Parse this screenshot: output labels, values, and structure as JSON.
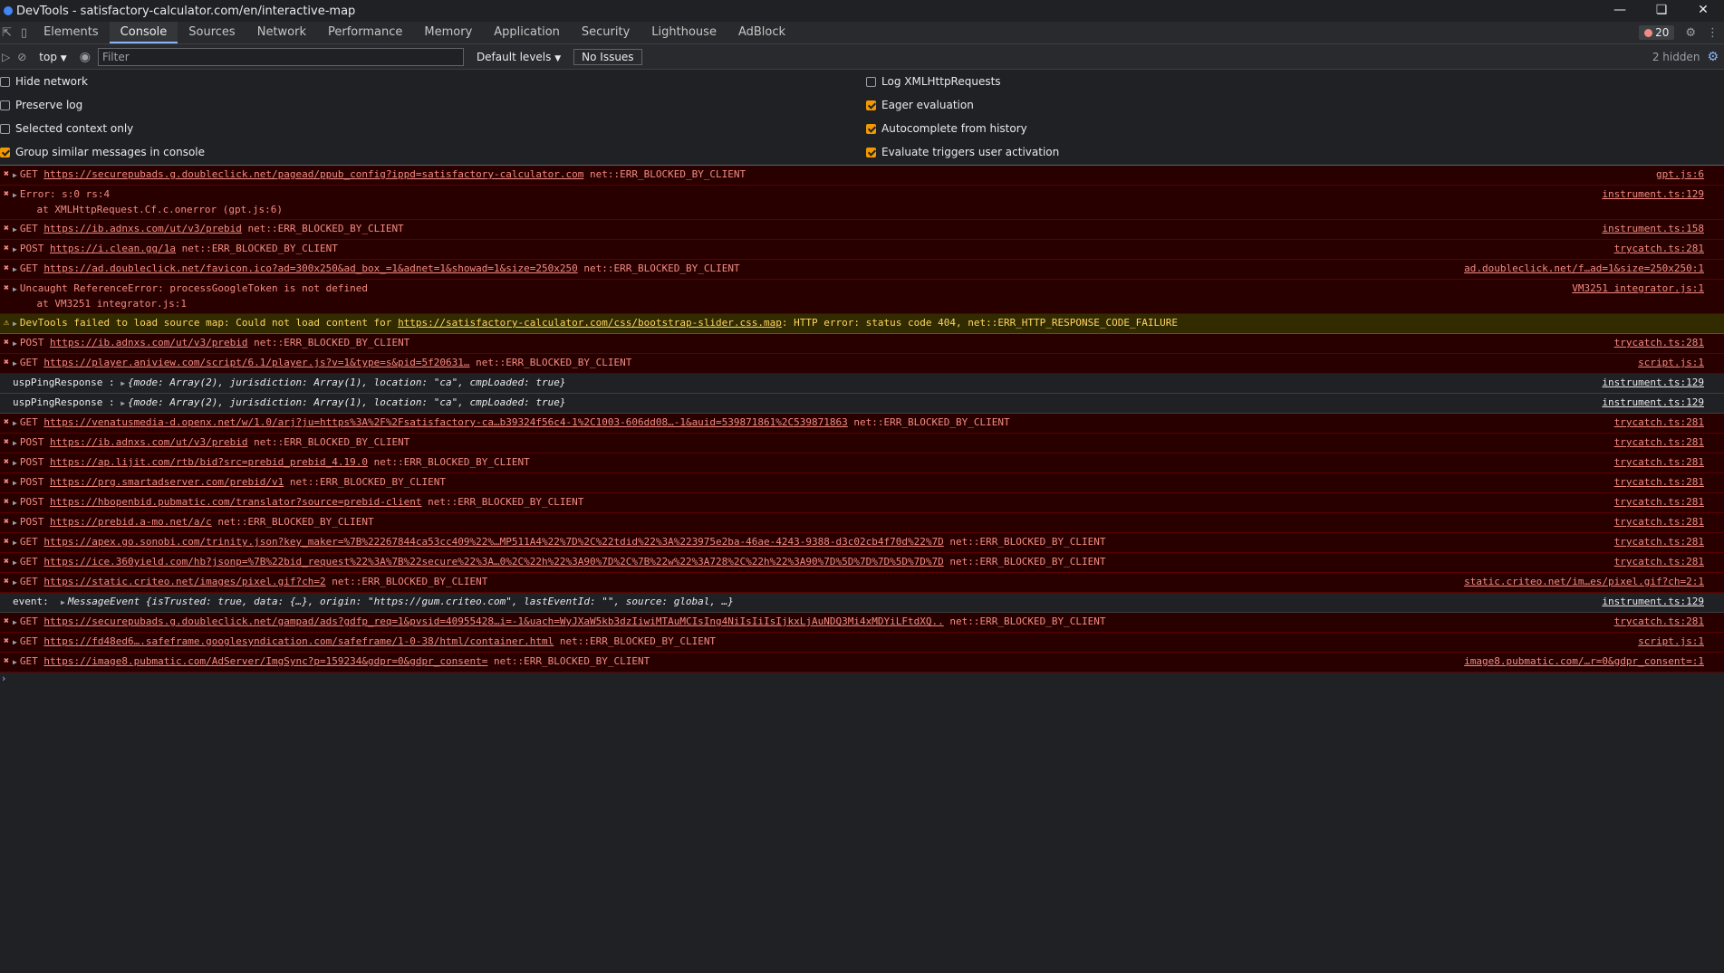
{
  "window": {
    "title": "DevTools - satisfactory-calculator.com/en/interactive-map"
  },
  "tabs": [
    "Elements",
    "Console",
    "Sources",
    "Network",
    "Performance",
    "Memory",
    "Application",
    "Security",
    "Lighthouse",
    "AdBlock"
  ],
  "error_count": "20",
  "toolbar": {
    "context": "top",
    "filter_placeholder": "Filter",
    "levels": "Default levels",
    "issues": "No Issues",
    "hidden": "2 hidden"
  },
  "settings": {
    "left": [
      {
        "label": "Hide network",
        "checked": false
      },
      {
        "label": "Preserve log",
        "checked": false
      },
      {
        "label": "Selected context only",
        "checked": false
      },
      {
        "label": "Group similar messages in console",
        "checked": true
      }
    ],
    "right": [
      {
        "label": "Log XMLHttpRequests",
        "checked": false
      },
      {
        "label": "Eager evaluation",
        "checked": true
      },
      {
        "label": "Autocomplete from history",
        "checked": true
      },
      {
        "label": "Evaluate triggers user activation",
        "checked": true
      }
    ]
  },
  "messages": [
    {
      "level": "error",
      "method": "GET",
      "url": "https://securepubads.g.doubleclick.net/pagead/ppub_config?ippd=satisfactory-calculator.com",
      "rest": " net::ERR_BLOCKED_BY_CLIENT",
      "source": "gpt.js:6"
    },
    {
      "level": "error",
      "text": "Error: s:0 rs:4",
      "line2": "    at XMLHttpRequest.Cf.c.onerror (gpt.js:6)",
      "source": "instrument.ts:129"
    },
    {
      "level": "error",
      "method": "GET",
      "url": "https://ib.adnxs.com/ut/v3/prebid",
      "rest": " net::ERR_BLOCKED_BY_CLIENT",
      "source": "instrument.ts:158"
    },
    {
      "level": "error",
      "method": "POST",
      "url": "https://i.clean.gg/1a",
      "rest": " net::ERR_BLOCKED_BY_CLIENT",
      "source": "trycatch.ts:281"
    },
    {
      "level": "error",
      "method": "GET",
      "url": "https://ad.doubleclick.net/favicon.ico?ad=300x250&ad_box_=1&adnet=1&showad=1&size=250x250",
      "rest": " net::ERR_BLOCKED_BY_CLIENT",
      "source": "ad.doubleclick.net/f…ad=1&size=250x250:1"
    },
    {
      "level": "error",
      "text": "Uncaught ReferenceError: processGoogleToken is not defined",
      "line2": "    at VM3251 integrator.js:1",
      "source": "VM3251 integrator.js:1"
    },
    {
      "level": "warning",
      "text": "DevTools failed to load source map: Could not load content for ",
      "url": "https://satisfactory-calculator.com/css/bootstrap-slider.css.map",
      "rest": ": HTTP error: status code 404, net::ERR_HTTP_RESPONSE_CODE_FAILURE",
      "source": ""
    },
    {
      "level": "error",
      "method": "POST",
      "url": "https://ib.adnxs.com/ut/v3/prebid",
      "rest": " net::ERR_BLOCKED_BY_CLIENT",
      "source": "trycatch.ts:281"
    },
    {
      "level": "error",
      "method": "GET",
      "url": "https://player.aniview.com/script/6.1/player.js?v=1&type=s&pid=5f20631…",
      "rest": " net::ERR_BLOCKED_BY_CLIENT",
      "source": "script.js:1"
    },
    {
      "level": "info",
      "text": "uspPingResponse : ",
      "obj": "{mode: Array(2), jurisdiction: Array(1), location: \"ca\", cmpLoaded: true}",
      "source": "instrument.ts:129"
    },
    {
      "level": "info",
      "text": "uspPingResponse : ",
      "obj": "{mode: Array(2), jurisdiction: Array(1), location: \"ca\", cmpLoaded: true}",
      "source": "instrument.ts:129"
    },
    {
      "level": "error",
      "method": "GET",
      "url": "https://venatusmedia-d.openx.net/w/1.0/arj?ju=https%3A%2F%2Fsatisfactory-ca…b39324f56c4-1%2C1003-606dd08…-1&auid=539871861%2C539871863",
      "rest": " net::ERR_BLOCKED_BY_CLIENT",
      "source": "trycatch.ts:281"
    },
    {
      "level": "error",
      "method": "POST",
      "url": "https://ib.adnxs.com/ut/v3/prebid",
      "rest": " net::ERR_BLOCKED_BY_CLIENT",
      "source": "trycatch.ts:281"
    },
    {
      "level": "error",
      "method": "POST",
      "url": "https://ap.lijit.com/rtb/bid?src=prebid_prebid_4.19.0",
      "rest": " net::ERR_BLOCKED_BY_CLIENT",
      "source": "trycatch.ts:281"
    },
    {
      "level": "error",
      "method": "POST",
      "url": "https://prg.smartadserver.com/prebid/v1",
      "rest": " net::ERR_BLOCKED_BY_CLIENT",
      "source": "trycatch.ts:281"
    },
    {
      "level": "error",
      "method": "POST",
      "url": "https://hbopenbid.pubmatic.com/translator?source=prebid-client",
      "rest": " net::ERR_BLOCKED_BY_CLIENT",
      "source": "trycatch.ts:281"
    },
    {
      "level": "error",
      "method": "POST",
      "url": "https://prebid.a-mo.net/a/c",
      "rest": " net::ERR_BLOCKED_BY_CLIENT",
      "source": "trycatch.ts:281"
    },
    {
      "level": "error",
      "method": "GET",
      "url": "https://apex.go.sonobi.com/trinity.json?key_maker=%7B%22267844ca53cc409%22%…MP511A4%22%7D%2C%22tdid%22%3A%223975e2ba-46ae-4243-9388-d3c02cb4f70d%22%7D",
      "rest": " net::ERR_BLOCKED_BY_CLIENT",
      "source": "trycatch.ts:281"
    },
    {
      "level": "error",
      "method": "GET",
      "url": "https://ice.360yield.com/hb?jsonp=%7B%22bid_request%22%3A%7B%22secure%22%3A…0%2C%22h%22%3A90%7D%2C%7B%22w%22%3A728%2C%22h%22%3A90%7D%5D%7D%7D%5D%7D%7D",
      "rest": " net::ERR_BLOCKED_BY_CLIENT",
      "source": "trycatch.ts:281"
    },
    {
      "level": "error",
      "method": "GET",
      "url": "https://static.criteo.net/images/pixel.gif?ch=2",
      "rest": " net::ERR_BLOCKED_BY_CLIENT",
      "source": "static.criteo.net/im…es/pixel.gif?ch=2:1"
    },
    {
      "level": "info",
      "text": "event:  ",
      "obj": "MessageEvent {isTrusted: true, data: {…}, origin: \"https://gum.criteo.com\", lastEventId: \"\", source: global, …}",
      "source": "instrument.ts:129"
    },
    {
      "level": "error",
      "method": "GET",
      "url": "https://securepubads.g.doubleclick.net/gampad/ads?gdfp_req=1&pvsid=40955428…i=-1&uach=WyJXaW5kb3dzIiwiMTAuMCIsIng4NiIsIiIsIjkxLjAuNDQ3Mi4xMDYiLFtdXQ..",
      "rest": " net::ERR_BLOCKED_BY_CLIENT",
      "source": "trycatch.ts:281"
    },
    {
      "level": "error",
      "method": "GET",
      "url": "https://fd48ed6….safeframe.googlesyndication.com/safeframe/1-0-38/html/container.html",
      "rest": " net::ERR_BLOCKED_BY_CLIENT",
      "source": "script.js:1"
    },
    {
      "level": "error",
      "method": "GET",
      "url": "https://image8.pubmatic.com/AdServer/ImgSync?p=159234&gdpr=0&gdpr_consent=",
      "rest": " net::ERR_BLOCKED_BY_CLIENT",
      "source": "image8.pubmatic.com/…r=0&gdpr_consent=:1"
    }
  ]
}
